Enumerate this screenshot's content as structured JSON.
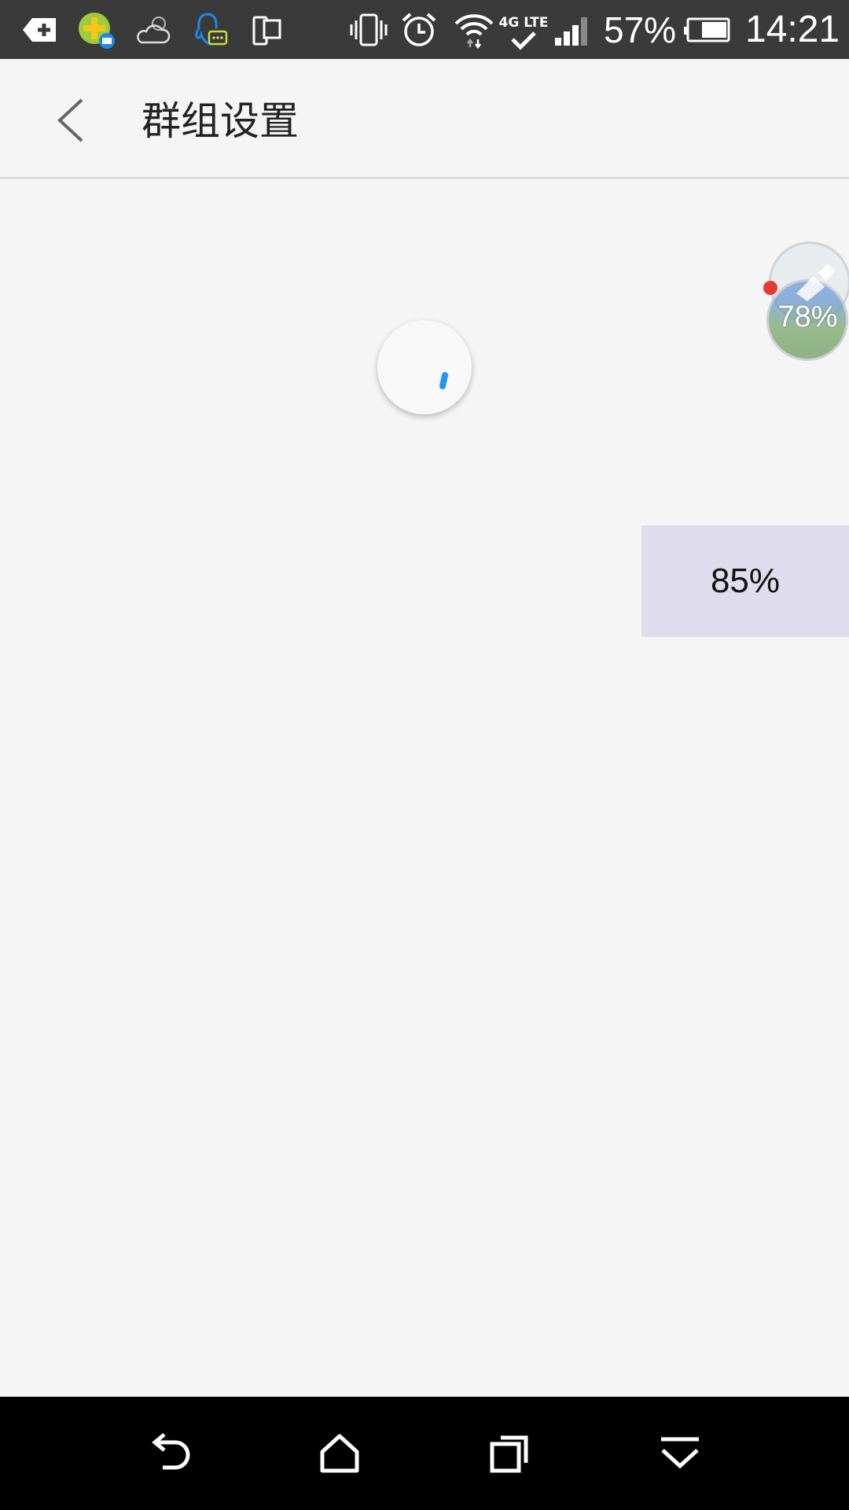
{
  "status_bar": {
    "battery_percent": "57%",
    "time": "14:21",
    "network_label": "4G LTE",
    "icons": [
      "notification-add-icon",
      "mail-app-icon",
      "weather-cloud-icon",
      "qq-chat-icon",
      "phone-screen-icon",
      "vibrate-icon",
      "alarm-icon",
      "wifi-icon",
      "lte-icon",
      "signal-icon",
      "battery-icon"
    ]
  },
  "header": {
    "title": "群组设置",
    "back_icon": "chevron-left-icon"
  },
  "loading": {
    "spinner_color": "#2196f3"
  },
  "floating_widget": {
    "percent": "78%"
  },
  "progress_box": {
    "percent": "85%"
  },
  "nav_bar": {
    "icons": [
      "back-icon",
      "home-icon",
      "recents-icon",
      "dropdown-icon"
    ]
  },
  "colors": {
    "status_bar": "#3a3a3a",
    "background": "#f5f5f5",
    "nav_bar": "#000000",
    "progress_box": "#dfdcee",
    "accent": "#2196f3"
  }
}
